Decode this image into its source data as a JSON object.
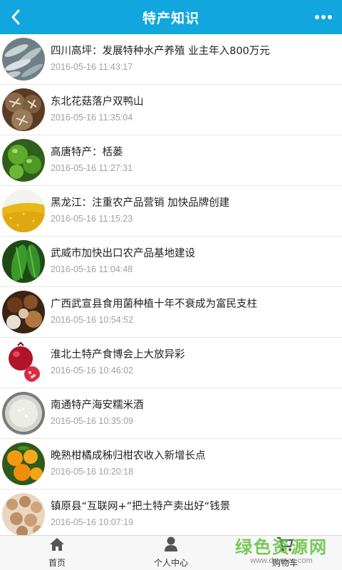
{
  "header": {
    "title": "特产知识",
    "back_icon": "chevron-left-icon",
    "more_icon": "more-dots-icon",
    "bg_color": "#11a6de"
  },
  "articles": [
    {
      "title": "四川高坪：发展特种水产养殖 业主年入800万元",
      "time": "2016-05-16 11:43:17",
      "thumb": "fish"
    },
    {
      "title": "东北花菇落户双鸭山",
      "time": "2016-05-16 11:35:04",
      "thumb": "mushroom"
    },
    {
      "title": "高唐特产：栝蒌",
      "time": "2016-05-16 11:27:31",
      "thumb": "green-fruit"
    },
    {
      "title": "黑龙江：注重农产品营销 加快品牌创建",
      "time": "2016-05-16 11:15:23",
      "thumb": "millet"
    },
    {
      "title": "武威市加快出口农产品基地建设",
      "time": "2016-05-16 11:04:48",
      "thumb": "bitter-melon"
    },
    {
      "title": "广西武宣县食用菌种植十年不衰成为富民支柱",
      "time": "2016-05-16 10:54:52",
      "thumb": "fungi"
    },
    {
      "title": "淮北土特产食博会上大放异彩",
      "time": "2016-05-16 10:46:02",
      "thumb": "pomegranate"
    },
    {
      "title": "南通特产海安糯米酒",
      "time": "2016-05-16 10:35:09",
      "thumb": "rice-wine"
    },
    {
      "title": "晚熟柑橘成秭归柑农收入新增长点",
      "time": "2016-05-16 10:20:18",
      "thumb": "oranges"
    },
    {
      "title": "镇原县“互联网+”把土特产卖出好“钱景",
      "time": "2016-05-16 10:07:19",
      "thumb": "nuts"
    }
  ],
  "tabbar": {
    "tabs": [
      {
        "label": "首页",
        "icon": "home-icon"
      },
      {
        "label": "个人中心",
        "icon": "user-icon"
      },
      {
        "label": "购物车",
        "icon": "cart-icon"
      }
    ]
  },
  "watermark": {
    "text": "绿色资源网",
    "url": "www.downcc.com"
  }
}
